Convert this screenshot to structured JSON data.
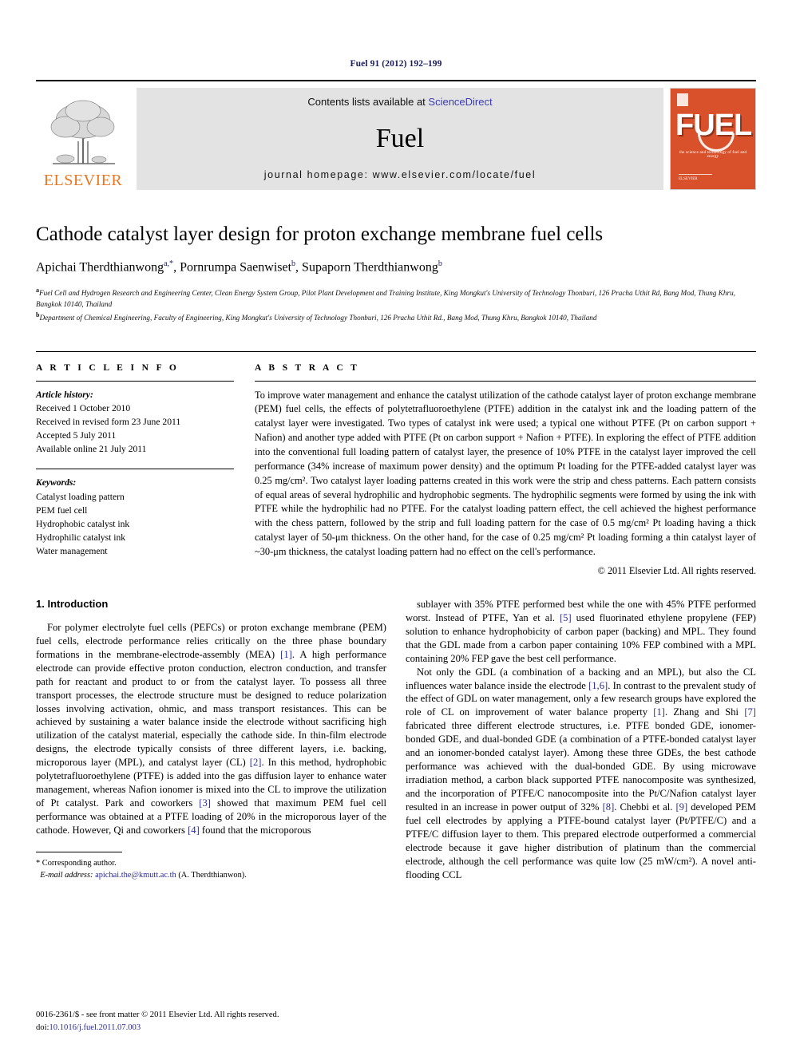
{
  "running_head": "Fuel 91 (2012) 192–199",
  "masthead": {
    "publisher_name": "ELSEVIER",
    "contents_prefix": "Contents lists available at ",
    "contents_link": "ScienceDirect",
    "journal_title": "Fuel",
    "homepage": "journal homepage: www.elsevier.com/locate/fuel",
    "cover": {
      "wordmark": "FUEL",
      "subtitle": "the science and technology of fuel and energy",
      "footer": "ELSEVIER",
      "bg_color": "#d9512a"
    },
    "link_color": "#3b3bb5",
    "brand_orange": "#E87722"
  },
  "title": "Cathode catalyst layer design for proton exchange membrane fuel cells",
  "authors": [
    {
      "name": "Apichai Therdthianwong",
      "marks": "a,*"
    },
    {
      "name": "Pornrumpa Saenwiset",
      "marks": "b"
    },
    {
      "name": "Supaporn Therdthianwong",
      "marks": "b"
    }
  ],
  "affiliations": [
    {
      "mark": "a",
      "text": "Fuel Cell and Hydrogen Research and Engineering Center, Clean Energy System Group, Pilot Plant Development and Training Institute, King Mongkut's University of Technology Thonburi, 126 Pracha Uthit Rd, Bang Mod, Thung Khru, Bangkok 10140, Thailand"
    },
    {
      "mark": "b",
      "text": "Department of Chemical Engineering, Faculty of Engineering, King Mongkut's University of Technology Thonburi, 126 Pracha Uthit Rd., Bang Mod, Thung Khru, Bangkok 10140, Thailand"
    }
  ],
  "article_info": {
    "heading": "A R T I C L E   I N F O",
    "history_label": "Article history:",
    "history": [
      "Received 1 October 2010",
      "Received in revised form 23 June 2011",
      "Accepted 5 July 2011",
      "Available online 21 July 2011"
    ],
    "keywords_label": "Keywords:",
    "keywords": [
      "Catalyst loading pattern",
      "PEM fuel cell",
      "Hydrophobic catalyst ink",
      "Hydrophilic catalyst ink",
      "Water management"
    ]
  },
  "abstract": {
    "heading": "A B S T R A C T",
    "text": "To improve water management and enhance the catalyst utilization of the cathode catalyst layer of proton exchange membrane (PEM) fuel cells, the effects of polytetrafluoroethylene (PTFE) addition in the catalyst ink and the loading pattern of the catalyst layer were investigated. Two types of catalyst ink were used; a typical one without PTFE (Pt on carbon support + Nafion) and another type added with PTFE (Pt on carbon support + Nafion + PTFE). In exploring the effect of PTFE addition into the conventional full loading pattern of catalyst layer, the presence of 10% PTFE in the catalyst layer improved the cell performance (34% increase of maximum power density) and the optimum Pt loading for the PTFE-added catalyst layer was 0.25 mg/cm². Two catalyst layer loading patterns created in this work were the strip and chess patterns. Each pattern consists of equal areas of several hydrophilic and hydrophobic segments. The hydrophilic segments were formed by using the ink with PTFE while the hydrophilic had no PTFE. For the catalyst loading pattern effect, the cell achieved the highest performance with the chess pattern, followed by the strip and full loading pattern for the case of 0.5 mg/cm² Pt loading having a thick catalyst layer of 50-μm thickness. On the other hand, for the case of 0.25 mg/cm² Pt loading forming a thin catalyst layer of ~30-μm thickness, the catalyst loading pattern had no effect on the cell's performance.",
    "copyright": "© 2011 Elsevier Ltd. All rights reserved."
  },
  "section": {
    "number_title": "1. Introduction",
    "left_paragraph_1": "For polymer electrolyte fuel cells (PEFCs) or proton exchange membrane (PEM) fuel cells, electrode performance relies critically on the three phase boundary formations in the membrane-electrode-assembly (MEA) [1]. A high performance electrode can provide effective proton conduction, electron conduction, and transfer path for reactant and product to or from the catalyst layer. To possess all three transport processes, the electrode structure must be designed to reduce polarization losses involving activation, ohmic, and mass transport resistances. This can be achieved by sustaining a water balance inside the electrode without sacrificing high utilization of the catalyst material, especially the cathode side. In thin-film electrode designs, the electrode typically consists of three different layers, i.e. backing, microporous layer (MPL), and catalyst layer (CL) [2]. In this method, hydrophobic polytetrafluoroethylene (PTFE) is added into the gas diffusion layer to enhance water management, whereas Nafion ionomer is mixed into the CL to improve the utilization of Pt catalyst. Park and coworkers [3] showed that maximum PEM fuel cell performance was obtained at a PTFE loading of 20% in the microporous layer of the cathode. However, Qi and coworkers [4] found that the microporous",
    "right_paragraph_1": "sublayer with 35% PTFE performed best while the one with 45% PTFE performed worst. Instead of PTFE, Yan et al. [5] used fluorinated ethylene propylene (FEP) solution to enhance hydrophobicity of carbon paper (backing) and MPL. They found that the GDL made from a carbon paper containing 10% FEP combined with a MPL containing 20% FEP gave the best cell performance.",
    "right_paragraph_2": "Not only the GDL (a combination of a backing and an MPL), but also the CL influences water balance inside the electrode [1,6]. In contrast to the prevalent study of the effect of GDL on water management, only a few research groups have explored the role of CL on improvement of water balance property [1]. Zhang and Shi [7] fabricated three different electrode structures, i.e. PTFE bonded GDE, ionomer-bonded GDE, and dual-bonded GDE (a combination of a PTFE-bonded catalyst layer and an ionomer-bonded catalyst layer). Among these three GDEs, the best cathode performance was achieved with the dual-bonded GDE. By using microwave irradiation method, a carbon black supported PTFE nanocomposite was synthesized, and the incorporation of PTFE/C nanocomposite into the Pt/C/Nafion catalyst layer resulted in an increase in power output of 32% [8]. Chebbi et al. [9] developed PEM fuel cell electrodes by applying a PTFE-bound catalyst layer (Pt/PTFE/C) and a PTFE/C diffusion layer to them. This prepared electrode outperformed a commercial electrode because it gave higher distribution of platinum than the commercial electrode, although the cell performance was quite low (25 mW/cm²). A novel anti-flooding CCL"
  },
  "footnotes": {
    "corresponding": "* Corresponding author.",
    "email_label": "E-mail address:",
    "email": "apichai.the@kmutt.ac.th",
    "email_owner": "(A. Therdthianwon)."
  },
  "page_footer": {
    "issn_line": "0016-2361/$ - see front matter © 2011 Elsevier Ltd. All rights reserved.",
    "doi_label": "doi:",
    "doi": "10.1016/j.fuel.2011.07.003"
  }
}
